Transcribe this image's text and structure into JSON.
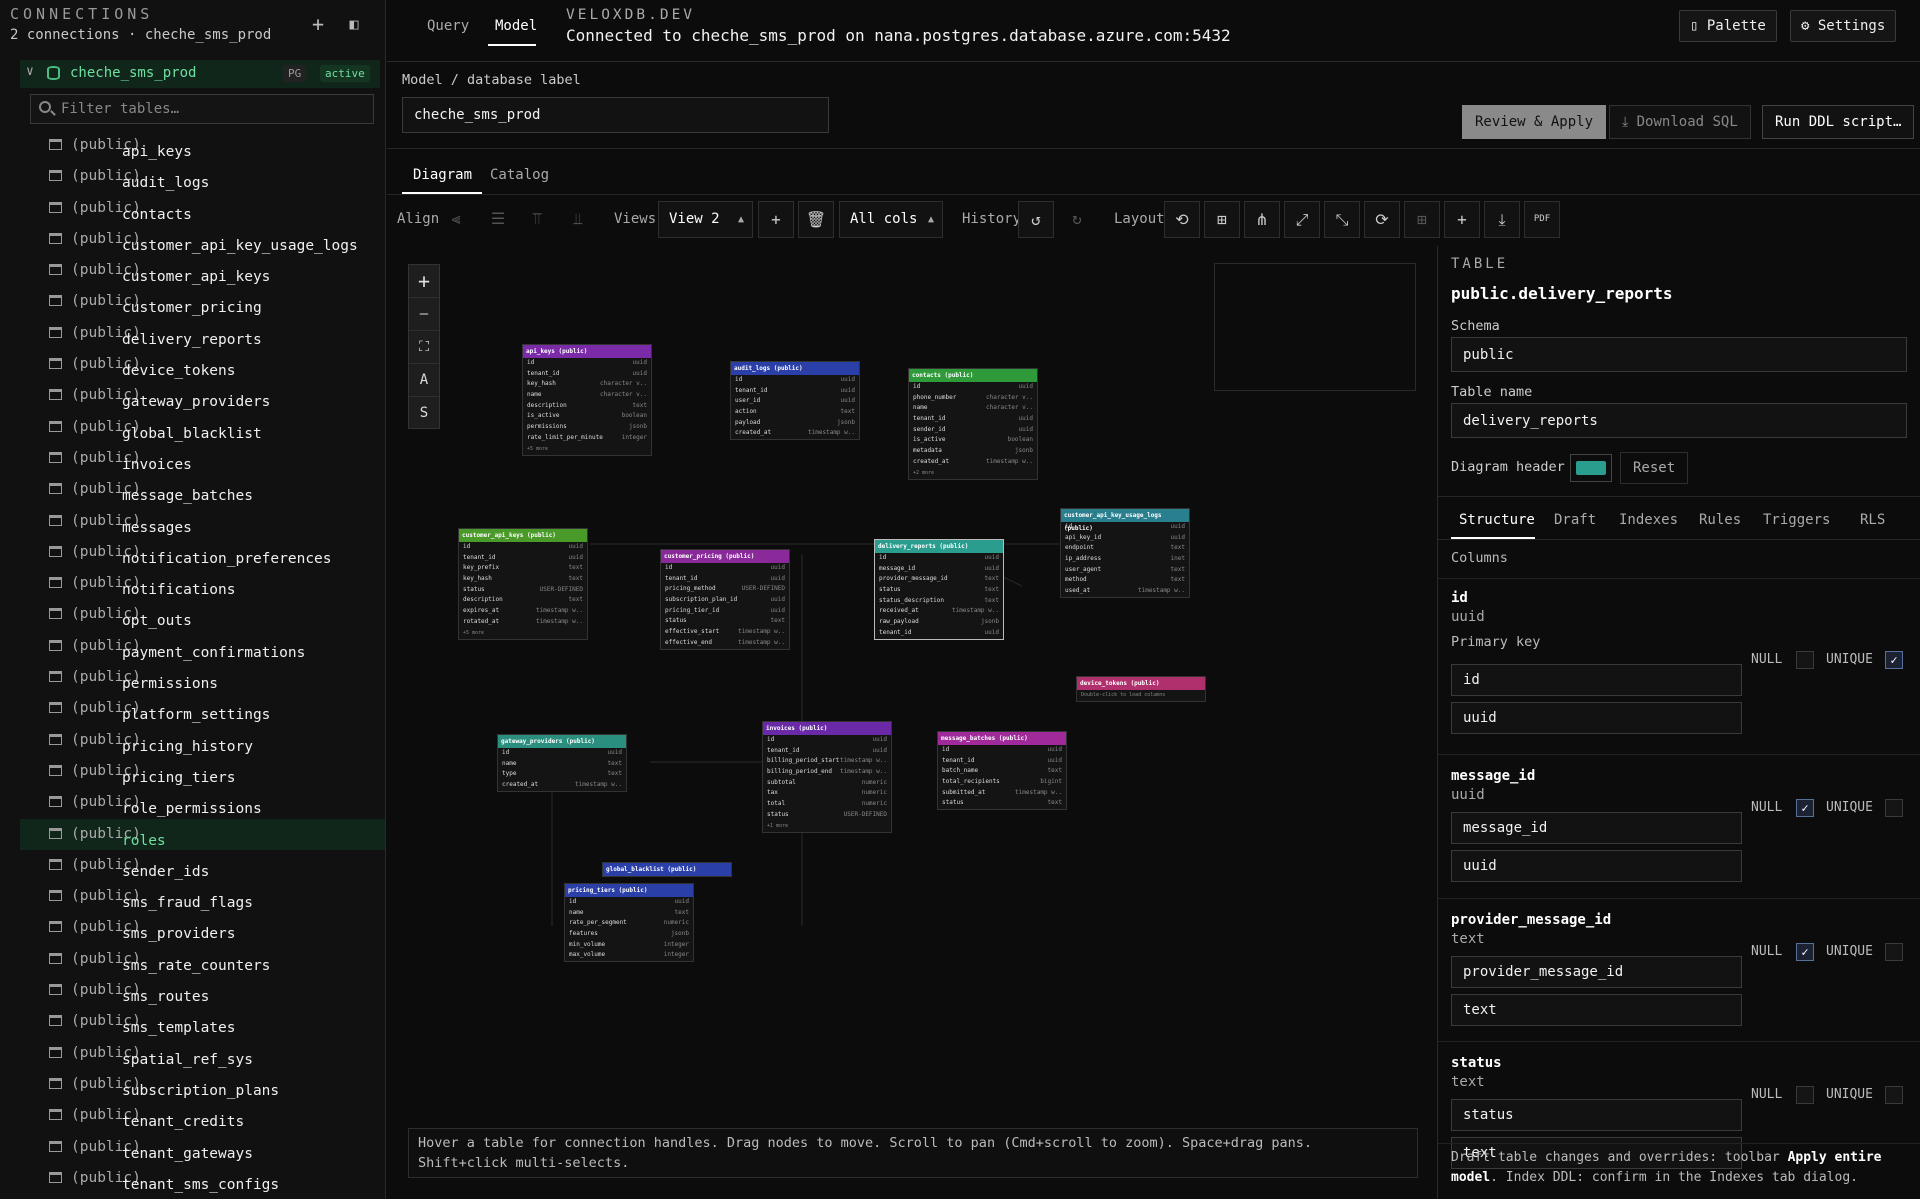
{
  "sidebar": {
    "title": "CONNECTIONS",
    "subtitle": "2 connections · cheche_sms_prod",
    "connection": {
      "name": "cheche_sms_prod",
      "badge_engine": "PG",
      "badge_status": "active"
    },
    "filter_placeholder": "Filter tables…",
    "schema_suffix": "(public)",
    "tables": [
      "api_keys",
      "audit_logs",
      "contacts",
      "customer_api_key_usage_logs",
      "customer_api_keys",
      "customer_pricing",
      "delivery_reports",
      "device_tokens",
      "gateway_providers",
      "global_blacklist",
      "invoices",
      "message_batches",
      "messages",
      "notification_preferences",
      "notifications",
      "opt_outs",
      "payment_confirmations",
      "permissions",
      "platform_settings",
      "pricing_history",
      "pricing_tiers",
      "role_permissions",
      "roles",
      "sender_ids",
      "sms_fraud_flags",
      "sms_providers",
      "sms_rate_counters",
      "sms_routes",
      "sms_templates",
      "spatial_ref_sys",
      "subscription_plans",
      "tenant_credits",
      "tenant_gateways",
      "tenant_sms_configs"
    ],
    "selected_table": "roles"
  },
  "topbar": {
    "tabs": [
      "Query",
      "Model"
    ],
    "active_tab": "Model",
    "brand": "VELOXDB.DEV",
    "connection_text": "Connected to cheche_sms_prod on nana.postgres.database.azure.com:5432",
    "palette_label": "Palette",
    "settings_label": "Settings"
  },
  "model": {
    "label": "Model / database label",
    "value": "cheche_sms_prod",
    "review_label": "Review & Apply",
    "download_label": "Download SQL",
    "run_label": "Run DDL script…"
  },
  "content_tabs": [
    "Diagram",
    "Catalog"
  ],
  "toolbar": {
    "align_label": "Align",
    "views_label": "Views",
    "view_value": "View 2",
    "cols_value": "All cols",
    "history_label": "History",
    "layout_label": "Layout"
  },
  "zoom": {
    "zoom_in": "+",
    "zoom_out": "—",
    "auto_label": "A",
    "snap_label": "S"
  },
  "diagram_tables": [
    {
      "title": "api_keys (public)",
      "color": "#7b2aa8",
      "cols": [
        [
          "id",
          "uuid"
        ],
        [
          "tenant_id",
          "uuid"
        ],
        [
          "key_hash",
          "character v.."
        ],
        [
          "name",
          "character v.."
        ],
        [
          "description",
          "text"
        ],
        [
          "is_active",
          "boolean"
        ],
        [
          "permissions",
          "jsonb"
        ],
        [
          "rate_limit_per_minute",
          "integer"
        ]
      ],
      "more": "+5 more"
    },
    {
      "title": "audit_logs (public)",
      "color": "#2a3fa8",
      "cols": [
        [
          "id",
          "uuid"
        ],
        [
          "tenant_id",
          "uuid"
        ],
        [
          "user_id",
          "uuid"
        ],
        [
          "action",
          "text"
        ],
        [
          "payload",
          "jsonb"
        ],
        [
          "created_at",
          "timestamp w.."
        ]
      ],
      "more": ""
    },
    {
      "title": "contacts (public)",
      "color": "#2e9a3a",
      "cols": [
        [
          "id",
          "uuid"
        ],
        [
          "phone_number",
          "character v.."
        ],
        [
          "name",
          "character v.."
        ],
        [
          "tenant_id",
          "uuid"
        ],
        [
          "sender_id",
          "uuid"
        ],
        [
          "is_active",
          "boolean"
        ],
        [
          "metadata",
          "jsonb"
        ],
        [
          "created_at",
          "timestamp w.."
        ]
      ],
      "more": "+2 more"
    },
    {
      "title": "customer_api_key_usage_logs (public)",
      "color": "#2a7f8f",
      "cols": [
        [
          "id",
          "uuid"
        ],
        [
          "api_key_id",
          "uuid"
        ],
        [
          "endpoint",
          "text"
        ],
        [
          "ip_address",
          "inet"
        ],
        [
          "user_agent",
          "text"
        ],
        [
          "method",
          "text"
        ],
        [
          "used_at",
          "timestamp w.."
        ]
      ],
      "more": ""
    },
    {
      "title": "customer_api_keys (public)",
      "color": "#4a9a2a",
      "cols": [
        [
          "id",
          "uuid"
        ],
        [
          "tenant_id",
          "uuid"
        ],
        [
          "key_prefix",
          "text"
        ],
        [
          "key_hash",
          "text"
        ],
        [
          "status",
          "USER-DEFINED"
        ],
        [
          "description",
          "text"
        ],
        [
          "expires_at",
          "timestamp w.."
        ],
        [
          "rotated_at",
          "timestamp w.."
        ]
      ],
      "more": "+5 more"
    },
    {
      "title": "customer_pricing (public)",
      "color": "#8a2a9a",
      "cols": [
        [
          "id",
          "uuid"
        ],
        [
          "tenant_id",
          "uuid"
        ],
        [
          "pricing_method",
          "USER-DEFINED"
        ],
        [
          "subscription_plan_id",
          "uuid"
        ],
        [
          "pricing_tier_id",
          "uuid"
        ],
        [
          "status",
          "text"
        ],
        [
          "effective_start",
          "timestamp w.."
        ],
        [
          "effective_end",
          "timestamp w.."
        ]
      ],
      "more": ""
    },
    {
      "title": "delivery_reports (public)",
      "color": "#2a9d8f",
      "cols": [
        [
          "id",
          "uuid"
        ],
        [
          "message_id",
          "uuid"
        ],
        [
          "provider_message_id",
          "text"
        ],
        [
          "status",
          "text"
        ],
        [
          "status_description",
          "text"
        ],
        [
          "received_at",
          "timestamp w.."
        ],
        [
          "raw_payload",
          "jsonb"
        ],
        [
          "tenant_id",
          "uuid"
        ]
      ],
      "more": ""
    },
    {
      "title": "device_tokens (public)",
      "color": "#b0306e",
      "cols": [],
      "more": "Double-click to load columns"
    },
    {
      "title": "gateway_providers (public)",
      "color": "#2a8f7f",
      "cols": [
        [
          "id",
          "uuid"
        ],
        [
          "name",
          "text"
        ],
        [
          "type",
          "text"
        ],
        [
          "created_at",
          "timestamp w.."
        ]
      ],
      "more": ""
    },
    {
      "title": "invoices (public)",
      "color": "#6a2aa8",
      "cols": [
        [
          "id",
          "uuid"
        ],
        [
          "tenant_id",
          "uuid"
        ],
        [
          "billing_period_start",
          "timestamp w.."
        ],
        [
          "billing_period_end",
          "timestamp w.."
        ],
        [
          "subtotal",
          "numeric"
        ],
        [
          "tax",
          "numeric"
        ],
        [
          "total",
          "numeric"
        ],
        [
          "status",
          "USER-DEFINED"
        ]
      ],
      "more": "+1 more"
    },
    {
      "title": "message_batches (public)",
      "color": "#a02a9a",
      "cols": [
        [
          "id",
          "uuid"
        ],
        [
          "tenant_id",
          "uuid"
        ],
        [
          "batch_name",
          "text"
        ],
        [
          "total_recipients",
          "bigint"
        ],
        [
          "submitted_at",
          "timestamp w.."
        ],
        [
          "status",
          "text"
        ]
      ],
      "more": ""
    },
    {
      "title": "global_blacklist (public)",
      "color": "#2a3fa8",
      "cols": [],
      "more": ""
    },
    {
      "title": "pricing_tiers (public)",
      "color": "#2a3fa8",
      "cols": [
        [
          "id",
          "uuid"
        ],
        [
          "name",
          "text"
        ],
        [
          "rate_per_segment",
          "numeric"
        ],
        [
          "features",
          "jsonb"
        ],
        [
          "min_volume",
          "integer"
        ],
        [
          "max_volume",
          "integer"
        ]
      ],
      "more": ""
    }
  ],
  "hint": "Hover a table for connection handles. Drag nodes to move. Scroll to pan (Cmd+scroll to zoom). Space+drag pans. Shift+click multi-selects.",
  "panel": {
    "kicker": "TABLE",
    "title": "public.delivery_reports",
    "schema_label": "Schema",
    "schema_value": "public",
    "table_name_label": "Table name",
    "table_name_value": "delivery_reports",
    "header_label": "Diagram header",
    "header_color": "#2a9d8f",
    "reset_label": "Reset",
    "tabs": [
      "Structure",
      "Draft",
      "Indexes",
      "Rules",
      "Triggers",
      "RLS"
    ],
    "columns_label": "Columns",
    "null_label": "NULL",
    "unique_label": "UNIQUE",
    "pk_label": "Primary key",
    "columns": [
      {
        "name": "id",
        "type": "uuid",
        "pk": true,
        "null": false,
        "unique": true
      },
      {
        "name": "message_id",
        "type": "uuid",
        "pk": false,
        "null": true,
        "unique": false
      },
      {
        "name": "provider_message_id",
        "type": "text",
        "pk": false,
        "null": true,
        "unique": false
      },
      {
        "name": "status",
        "type": "text",
        "pk": false,
        "null": false,
        "unique": false
      }
    ],
    "footnote_pre": "Draft table changes and overrides: toolbar",
    "footnote_b1": "Apply entire model",
    "footnote_mid": ". Index DDL: confirm in the Indexes tab dialog."
  }
}
